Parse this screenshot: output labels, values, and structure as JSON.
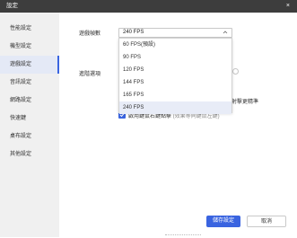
{
  "window": {
    "title": "設定",
    "close_glyph": "×"
  },
  "sidebar": {
    "items": [
      {
        "label": "性能設定"
      },
      {
        "label": "機型設定"
      },
      {
        "label": "遊戲設定"
      },
      {
        "label": "音訊設定"
      },
      {
        "label": "網路設定"
      },
      {
        "label": "快速鍵"
      },
      {
        "label": "桌布設定"
      },
      {
        "label": "其他設定"
      }
    ],
    "active_index": 2
  },
  "main": {
    "fps_label": "遊戲幀數",
    "fps_value": "240 FPS",
    "advanced_label": "進階選項",
    "fps_options": [
      {
        "label": "60 FPS(預設)"
      },
      {
        "label": "90 FPS"
      },
      {
        "label": "120 FPS"
      },
      {
        "label": "144 FPS"
      },
      {
        "label": "165 FPS"
      },
      {
        "label": "240 FPS"
      }
    ],
    "selected_option_index": 5,
    "partial_right_text": "射擊更精準",
    "checkbox_label": "啟用鍵鼠右鍵點擊",
    "checkbox_hint": "(效果等同鍵鼠左鍵)",
    "checkbox_checked": true
  },
  "footer": {
    "save_label": "儲存設定",
    "cancel_label": "取消"
  },
  "colors": {
    "accent": "#3a64e0",
    "titlebar": "#3d3d3d"
  }
}
